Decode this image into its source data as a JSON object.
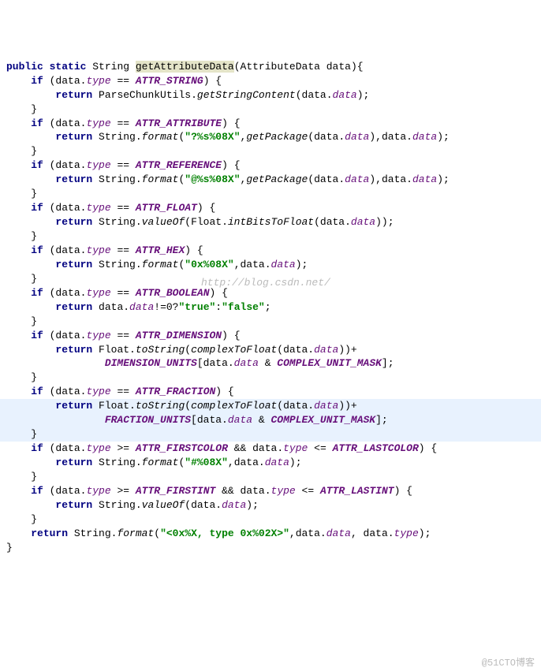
{
  "tokens": {
    "public": "public",
    "static": "static",
    "string": "String",
    "if": "if",
    "return": "return",
    "methodName": "getAttributeData",
    "paramType": "AttributeData",
    "paramName": "data",
    "type": "type",
    "data_f": "data",
    "ATTR_STRING": "ATTR_STRING",
    "ATTR_ATTRIBUTE": "ATTR_ATTRIBUTE",
    "ATTR_REFERENCE": "ATTR_REFERENCE",
    "ATTR_FLOAT": "ATTR_FLOAT",
    "ATTR_HEX": "ATTR_HEX",
    "ATTR_BOOLEAN": "ATTR_BOOLEAN",
    "ATTR_DIMENSION": "ATTR_DIMENSION",
    "ATTR_FRACTION": "ATTR_FRACTION",
    "ATTR_FIRSTCOLOR": "ATTR_FIRSTCOLOR",
    "ATTR_LASTCOLOR": "ATTR_LASTCOLOR",
    "ATTR_FIRSTINT": "ATTR_FIRSTINT",
    "ATTR_LASTINT": "ATTR_LASTINT",
    "ParseChunkUtils": "ParseChunkUtils",
    "getStringContent": "getStringContent",
    "format": "format",
    "getPackage": "getPackage",
    "valueOf": "valueOf",
    "Float": "Float",
    "intBitsToFloat": "intBitsToFloat",
    "toString": "toString",
    "complexToFloat": "complexToFloat",
    "DIMENSION_UNITS": "DIMENSION_UNITS",
    "FRACTION_UNITS": "FRACTION_UNITS",
    "COMPLEX_UNIT_MASK": "COMPLEX_UNIT_MASK",
    "s_attr": "\"?%s%08X\"",
    "s_ref": "\"@%s%08X\"",
    "s_hex": "\"0x%08X\"",
    "s_true": "\"true\"",
    "s_false": "\"false\"",
    "s_color": "\"#%08X\"",
    "s_last": "\"<0x%X, type 0x%02X>\""
  },
  "watermark1": "http://blog.csdn.net/",
  "watermark2": "@51CTO博客"
}
